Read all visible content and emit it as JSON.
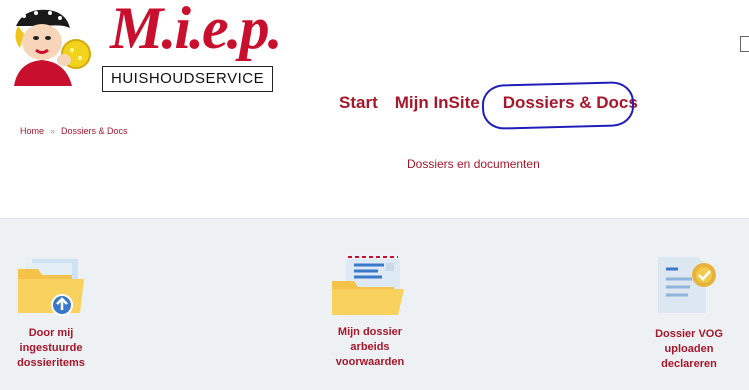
{
  "brand": {
    "name": "M.i.e.p.",
    "tagline": "HUISHOUDSERVICE"
  },
  "nav": {
    "items": [
      {
        "label": "Start"
      },
      {
        "label": "Mijn InSite"
      },
      {
        "label": "Dossiers & Docs"
      }
    ]
  },
  "breadcrumb": {
    "home": "Home",
    "separator": "»",
    "current": "Dossiers & Docs"
  },
  "page": {
    "subtitle": "Dossiers en documenten"
  },
  "tiles": [
    {
      "lines": [
        "Door mij",
        "ingestuurde",
        "dossieritems"
      ],
      "icon": "folder-upload-icon"
    },
    {
      "lines": [
        "Mijn dossier",
        "arbeids",
        "voorwaarden"
      ],
      "icon": "folder-letter-icon"
    },
    {
      "lines": [
        "Dossier VOG",
        "uploaden",
        "declareren"
      ],
      "icon": "document-badge-icon"
    }
  ],
  "colors": {
    "brand_red": "#a5172b",
    "annotation_blue": "#1f1fb8",
    "tiles_background": "#eef1f4"
  }
}
